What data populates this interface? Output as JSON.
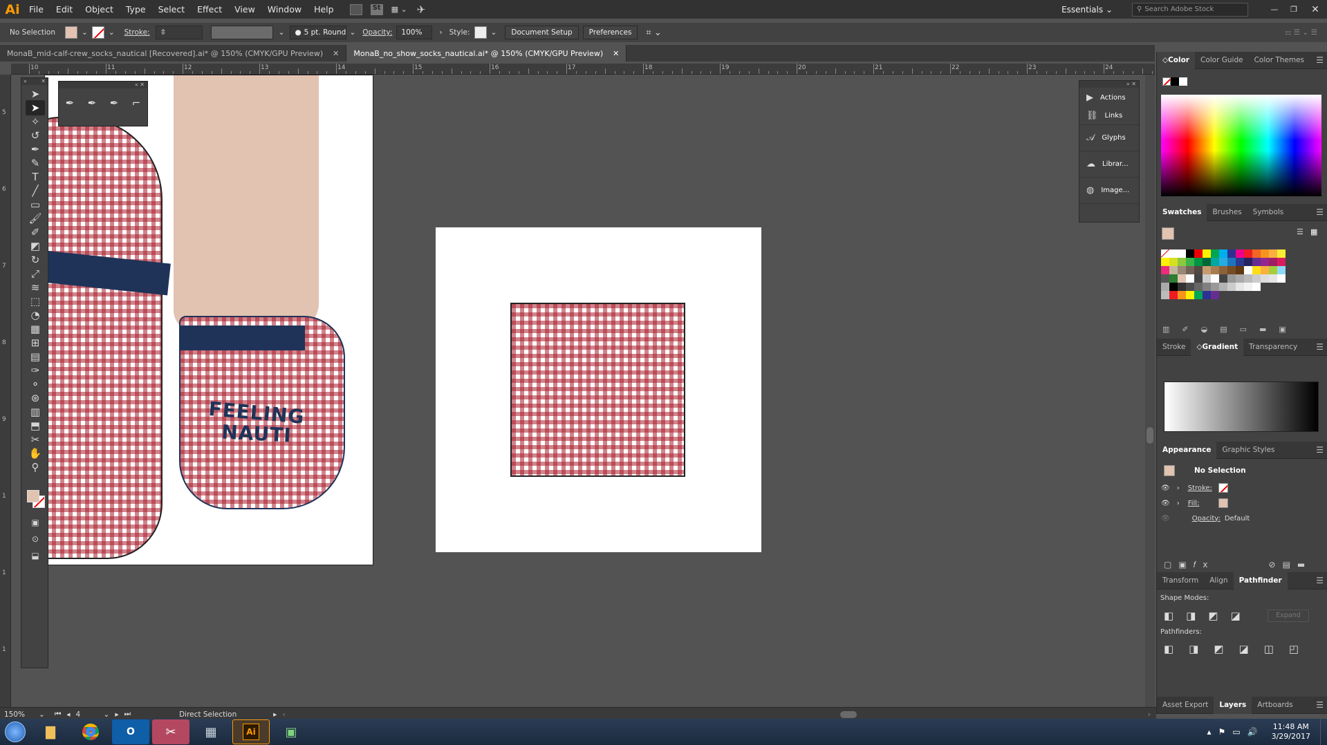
{
  "app": {
    "logo": "Ai"
  },
  "menubar": {
    "items": [
      "File",
      "Edit",
      "Object",
      "Type",
      "Select",
      "Effect",
      "View",
      "Window",
      "Help"
    ],
    "workspace": "Essentials",
    "search_placeholder": "Search Adobe Stock",
    "st_label": "St"
  },
  "controlbar": {
    "selection": "No Selection",
    "stroke_label": "Stroke:",
    "brush": "5 pt. Round",
    "opacity_label": "Opacity:",
    "opacity": "100%",
    "style_label": "Style:",
    "document_setup": "Document Setup",
    "preferences": "Preferences"
  },
  "tabs": [
    {
      "label": "MonaB_mid-calf-crew_socks_nautical [Recovered].ai* @ 150% (CMYK/GPU Preview)",
      "active": false
    },
    {
      "label": "MonaB_no_show_socks_nautical.ai* @ 150% (CMYK/GPU Preview)",
      "active": true
    }
  ],
  "ruler": {
    "top": [
      "10",
      "11",
      "12",
      "13",
      "14",
      "15",
      "16",
      "17",
      "18",
      "19",
      "20",
      "21",
      "22",
      "23",
      "24"
    ],
    "left": [
      "5",
      "6",
      "7",
      "8",
      "9",
      "1",
      "1",
      "1"
    ]
  },
  "artwork": {
    "sock_text_line1": "FEELING",
    "sock_text_line2": "NAUTI"
  },
  "float_panel": {
    "items": [
      {
        "label": "Actions",
        "icon": "play-icon"
      },
      {
        "label": "Links",
        "icon": "link-icon"
      },
      {
        "label": "Glyphs",
        "icon": "glyph-icon"
      },
      {
        "label": "Librar...",
        "icon": "libraries-icon"
      },
      {
        "label": "Image...",
        "icon": "image-trace-icon"
      }
    ]
  },
  "panels": {
    "color_tabs": [
      "Color",
      "Color Guide",
      "Color Themes"
    ],
    "swatch_tabs": [
      "Swatches",
      "Brushes",
      "Symbols"
    ],
    "gradient_tabs": [
      "Stroke",
      "Gradient",
      "Transparency"
    ],
    "appearance_tabs": [
      "Appearance",
      "Graphic Styles"
    ],
    "appearance": {
      "title": "No Selection",
      "stroke": "Stroke:",
      "fill": "Fill:",
      "opacity_label": "Opacity:",
      "opacity_value": "Default"
    },
    "pathfinder_tabs": [
      "Transform",
      "Align",
      "Pathfinder"
    ],
    "pathfinder": {
      "shape_modes": "Shape Modes:",
      "pathfinders": "Pathfinders:",
      "expand": "Expand"
    },
    "bottom_tabs": [
      "Asset Export",
      "Layers",
      "Artboards"
    ]
  },
  "statusbar": {
    "zoom": "150%",
    "artboard": "4",
    "tool": "Direct Selection"
  },
  "taskbar": {
    "time": "11:48 AM",
    "date": "3/29/2017"
  },
  "colors": {
    "accent": "#ff9a00",
    "gingham_red": "#aa1e2d",
    "navy": "#1f3358",
    "skin": "#e2c2b0"
  }
}
